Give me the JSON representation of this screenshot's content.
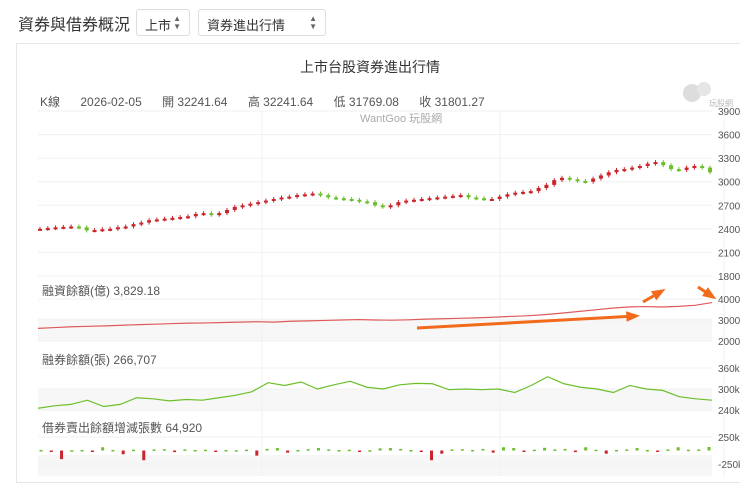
{
  "header": {
    "title": "資券與借券概況",
    "market_select": "上市",
    "type_select": "資券進出行情"
  },
  "chart": {
    "title": "上市台股資券進出行情",
    "kline": {
      "label": "K線",
      "date": "2026-02-05",
      "open": "開 32241.64",
      "high": "高 32241.64",
      "low": "低 31769.08",
      "close": "收 31801.27"
    },
    "watermark": "WantGoo 玩股網",
    "logo_text": "玩股網",
    "colors": {
      "up": "#c9252b",
      "down": "#6cbf2a",
      "margin": "#e05a5a",
      "short": "#6cbf2a",
      "arrow": "#f26a1b"
    }
  },
  "chart_data": [
    {
      "type": "candlestick",
      "name": "K線",
      "y_ticks": [
        "3900",
        "3600",
        "3300",
        "3000",
        "2700",
        "2400",
        "2100",
        "1800"
      ],
      "ylim": [
        1800,
        3900
      ],
      "close": [
        2400,
        2410,
        2420,
        2425,
        2430,
        2420,
        2380,
        2385,
        2395,
        2400,
        2420,
        2430,
        2460,
        2480,
        2510,
        2520,
        2530,
        2540,
        2550,
        2560,
        2590,
        2600,
        2580,
        2600,
        2640,
        2680,
        2700,
        2720,
        2740,
        2760,
        2780,
        2800,
        2810,
        2830,
        2840,
        2850,
        2830,
        2800,
        2790,
        2780,
        2770,
        2750,
        2740,
        2700,
        2680,
        2700,
        2740,
        2760,
        2770,
        2780,
        2790,
        2800,
        2810,
        2820,
        2830,
        2800,
        2790,
        2780,
        2780,
        2810,
        2840,
        2860,
        2870,
        2880,
        2920,
        2960,
        3020,
        3050,
        3030,
        3010,
        3000,
        3040,
        3080,
        3120,
        3150,
        3160,
        3180,
        3200,
        3230,
        3250,
        3210,
        3160,
        3150,
        3180,
        3200,
        3180,
        3120
      ]
    },
    {
      "type": "line",
      "name": "融資餘額(億)",
      "label": "融資餘額(億) 3,829.18",
      "y_ticks": [
        "4000",
        "3000",
        "2000"
      ],
      "ylim": [
        2000,
        4000
      ],
      "values": [
        2600,
        2640,
        2680,
        2700,
        2720,
        2750,
        2780,
        2800,
        2830,
        2850,
        2860,
        2880,
        2900,
        2920,
        2900,
        2940,
        2960,
        2980,
        3000,
        3020,
        3000,
        2990,
        3010,
        3040,
        3060,
        3080,
        3100,
        3130,
        3170,
        3200,
        3250,
        3320,
        3400,
        3480,
        3560,
        3620,
        3640,
        3620,
        3650,
        3700,
        3829
      ]
    },
    {
      "type": "line",
      "name": "融券餘額(張)",
      "label": "融券餘額(張) 266,707",
      "y_ticks": [
        "360k",
        "300k",
        "240k"
      ],
      "ylim": [
        240000,
        360000
      ],
      "values": [
        245,
        252,
        256,
        268,
        250,
        256,
        275,
        272,
        266,
        270,
        268,
        275,
        282,
        292,
        318,
        310,
        320,
        300,
        312,
        322,
        305,
        300,
        312,
        316,
        315,
        298,
        300,
        298,
        300,
        290,
        310,
        335,
        315,
        305,
        300,
        290,
        310,
        300,
        296,
        278,
        272,
        268
      ]
    },
    {
      "type": "bar",
      "name": "借券賣出餘額增減張數",
      "label": "借券賣出餘額增減張數 64,920",
      "y_ticks": [
        "250k",
        "-250k"
      ],
      "ylim": [
        -250000,
        250000
      ],
      "values": [
        10,
        -5,
        -160,
        5,
        10,
        -10,
        60,
        10,
        -70,
        15,
        -180,
        20,
        25,
        -30,
        20,
        10,
        15,
        -15,
        10,
        5,
        15,
        -95,
        30,
        45,
        -40,
        10,
        25,
        45,
        20,
        10,
        15,
        -20,
        5,
        40,
        45,
        30,
        10,
        -20,
        -180,
        -60,
        20,
        25,
        10,
        30,
        -40,
        60,
        45,
        -20,
        15,
        50,
        20,
        30,
        -30,
        60,
        15,
        -60,
        10,
        20,
        45,
        10,
        -15,
        20,
        60,
        15,
        20,
        65
      ]
    }
  ]
}
